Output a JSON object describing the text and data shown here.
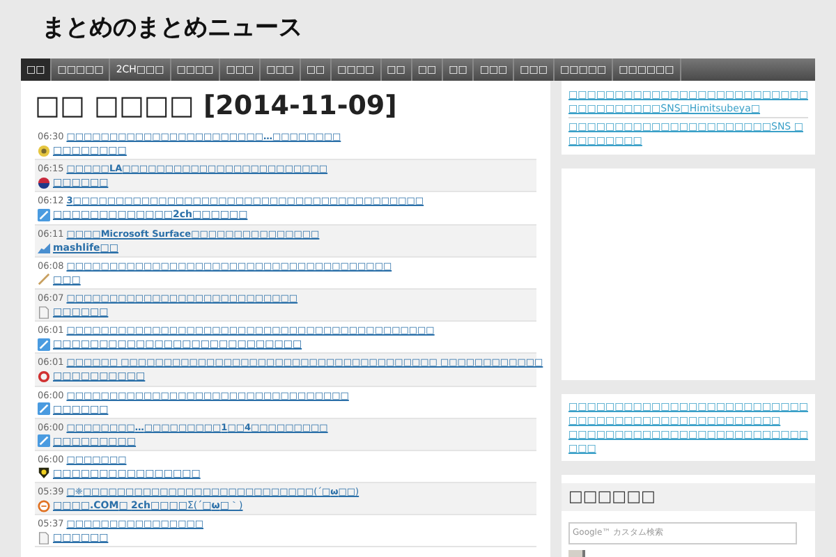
{
  "site_title": "まとめのまとめニュース",
  "nav": [
    {
      "label": "□□",
      "selected": true
    },
    {
      "label": "□□□□□",
      "selected": false
    },
    {
      "label": "2CH□□□",
      "selected": false
    },
    {
      "label": "□□□□",
      "selected": false
    },
    {
      "label": "□□□",
      "selected": false
    },
    {
      "label": "□□□",
      "selected": false
    },
    {
      "label": "□□",
      "selected": false
    },
    {
      "label": "□□□□",
      "selected": false
    },
    {
      "label": "□□",
      "selected": false
    },
    {
      "label": "□□",
      "selected": false
    },
    {
      "label": "□□",
      "selected": false
    },
    {
      "label": "□□□",
      "selected": false
    },
    {
      "label": "□□□",
      "selected": false
    },
    {
      "label": "□□□□□",
      "selected": false
    },
    {
      "label": "□□□□□□",
      "selected": false
    }
  ],
  "heading": "□□ □□□□ [2014-11-09]",
  "entries": [
    {
      "time": "06:30",
      "title": "□□□□□□□□□□□□□□□□□□□□□□□**…**□□□□□□□□",
      "source": "□□□□□□□□",
      "kind": "badge"
    },
    {
      "time": "06:15",
      "title": "□□□□□**LA**□□□□□□□□□□□□□□□□□□□□□□□□",
      "source": "□□□□□□",
      "kind": "flag"
    },
    {
      "time": "06:12",
      "title": "**3**□□□□□□□□□□□□□□□□□□□□□□□□□□□□□□□□□□□□□□□□□",
      "source": "□□□□□□□□□□□□□**2ch**□□□□□□",
      "kind": "pencil"
    },
    {
      "time": "06:11",
      "title": "□□□□**Microsoft Surface**□□□□□□□□□□□□□□□",
      "source": "**mashlife**□□",
      "kind": "chart"
    },
    {
      "time": "06:08",
      "title": "□□□□□□□□□□□□□□□□□□□□□□□□□□□□□□□□□□□□□□",
      "source": "□□□",
      "kind": "stick"
    },
    {
      "time": "06:07",
      "title": "□□□□□□□□□□□□□□□□□□□□□□□□□□□",
      "source": "□□□□□□",
      "kind": "doc"
    },
    {
      "time": "06:01",
      "title": "□□□□□□□□□□□□□□□□□□□□□□□□□□□□□□□□□□□□□□□□□□□",
      "source": "□□□□□□□□□□□□□□□□□□□□□□□□□□□",
      "kind": "pencil"
    },
    {
      "time": "06:01",
      "title": "□□□□□□ □□□□□□□□□□□□□□□□□□□□□□□□□□□□□□□□□□□□□ □□□□□□□□□□□□",
      "source": "□□□□□□□□□□",
      "kind": "ring"
    },
    {
      "time": "06:00",
      "title": "□□□□□□□□□□□□□□□□□□□□□□□□□□□□□□□□□",
      "source": "□□□□□□",
      "kind": "pencil"
    },
    {
      "time": "06:00",
      "title": "□□□□□□□□**…**□□□□□□□□□**1**□□**4**□□□□□□□□□",
      "source": "□□□□□□□□□",
      "kind": "pencil"
    },
    {
      "time": "06:00",
      "title": "□□□□□□□",
      "source": "□□□□□□□□□□□□□□□□",
      "kind": "shield"
    },
    {
      "time": "05:39",
      "title": "□**❈**□□□□□□□□□□□□□□□□□□□□□□□□□□□(´□**ω**□□)",
      "source": "□□□□**.COM**□ **2ch**□□□□Σ(´□**ω**□｀)",
      "kind": "circle"
    },
    {
      "time": "05:37",
      "title": "□□□□□□□□□□□□□□□□",
      "source": "□□□□□□",
      "kind": "doc"
    }
  ],
  "sidebar": {
    "links": [
      "□□□□□□□□□□□□□□□□□□□□□□□□□□□□□□□□□□□□SNS□Himitsubeya□",
      "□□□□□□□□□□□□□□□□□□□□□□SNS □□□□□□□□□"
    ],
    "links_2": [
      "□□□□□□□□□□□□□□□□□□□□□□□□□□□□□□□□□□□□□□□□□□□□□□□□□",
      "□□□□□□□□□□□□□□□□□□□□□□□□□□□□□"
    ],
    "search_title": "□□□□□□",
    "search": {
      "placeholder": "Google™ カスタム検索"
    }
  }
}
